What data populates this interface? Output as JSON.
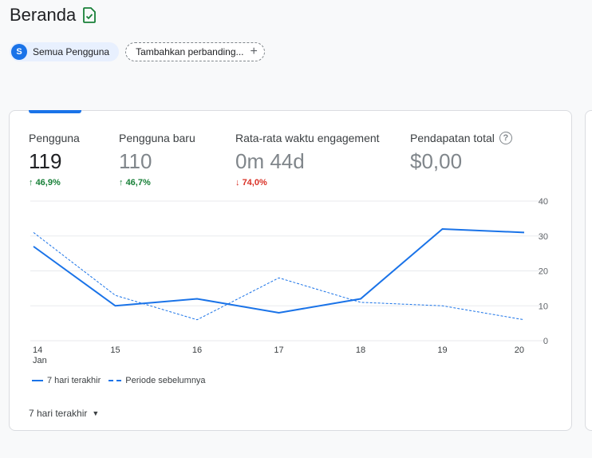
{
  "header": {
    "title": "Beranda"
  },
  "chips": {
    "user_initial": "S",
    "user_label": "Semua Pengguna",
    "compare_label": "Tambahkan perbanding..."
  },
  "metrics": [
    {
      "label": "Pengguna",
      "value": "119",
      "change": "46,9%",
      "direction": "up"
    },
    {
      "label": "Pengguna baru",
      "value": "110",
      "change": "46,7%",
      "direction": "up"
    },
    {
      "label": "Rata-rata waktu engagement",
      "value": "0m 44d",
      "change": "74,0%",
      "direction": "down"
    },
    {
      "label": "Pendapatan total",
      "value": "$0,00",
      "help": "?"
    }
  ],
  "chart_data": {
    "type": "line",
    "categories": [
      "14",
      "15",
      "16",
      "17",
      "18",
      "19",
      "20"
    ],
    "x_sublabel": "Jan",
    "y_ticks": [
      0,
      10,
      20,
      30,
      40
    ],
    "ylim": [
      0,
      40
    ],
    "grid": true,
    "legend_position": "bottom-left",
    "series": [
      {
        "name": "7 hari terakhir",
        "style": "solid",
        "values": [
          27,
          10,
          12,
          8,
          12,
          32,
          31
        ]
      },
      {
        "name": "Periode sebelumnya",
        "style": "dashed",
        "values": [
          31,
          13,
          6,
          18,
          11,
          10,
          6
        ]
      }
    ],
    "color": "#1a73e8"
  },
  "range": {
    "label": "7 hari terakhir"
  }
}
